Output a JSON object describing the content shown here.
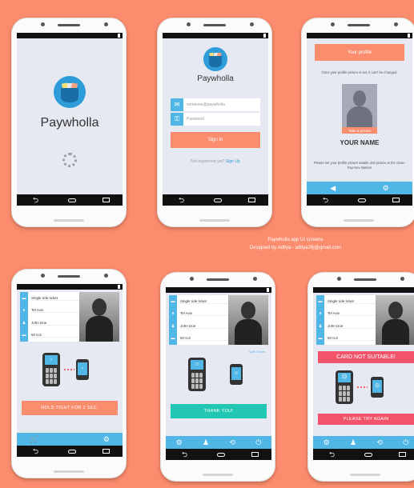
{
  "colors": {
    "background": "#fb8c6d",
    "accent_blue": "#4fb6e5",
    "accent_salmon": "#fb8c6d",
    "teal": "#22c7b3",
    "alert_red": "#f2556a"
  },
  "splash": {
    "brand": "Paywholla"
  },
  "login": {
    "brand": "Paywholla",
    "email_placeholder": "someone@paywholla",
    "password_placeholder": "Password",
    "sign_in": "Sign in",
    "not_registered": "Not registered yet?",
    "sign_up": "Sign Up"
  },
  "profile": {
    "header": "Your profile",
    "note_top": "Once your profile picture is set, it can't be changed.",
    "take_picture": "Take a picture",
    "name": "YOUR NAME",
    "note_bottom": "Please set your profile picture details and picture at the close-Pay-Kev station!"
  },
  "ticket": {
    "type": "Single ride ticket",
    "city": "Tel Aviv",
    "holder": "John Doe",
    "price": "50 ILS"
  },
  "screen4": {
    "message": "HOLD TIGHT FOR 2 SEC."
  },
  "screen5": {
    "link": "Safe Travel",
    "message": "THANK YOU!"
  },
  "screen6": {
    "banner": "CARD NOT SUITABLE!",
    "message": "PLEASE TRY AGAIN"
  },
  "caption": {
    "line1": "Paywholla app UI screens",
    "line2": "Designed by Aditya - aditya26j@gmail.com"
  }
}
